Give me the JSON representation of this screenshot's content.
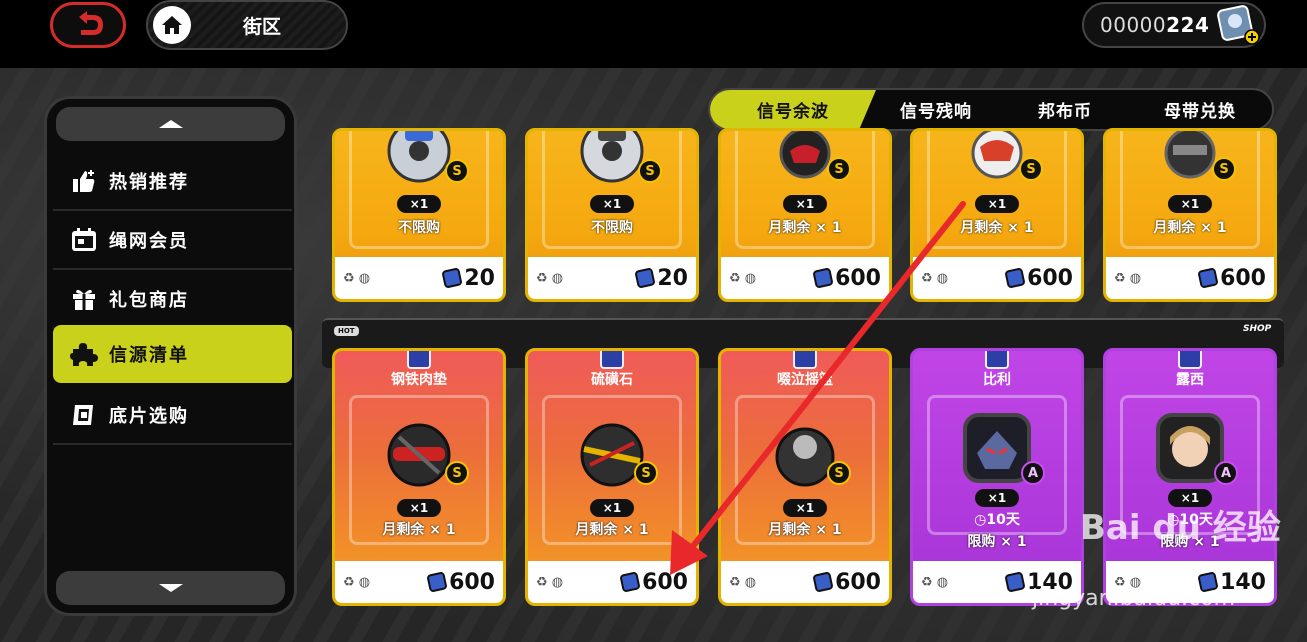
{
  "header": {
    "location": "街区",
    "currency_dim": "00000",
    "currency_value": "224"
  },
  "sidebar": {
    "items": [
      {
        "label": "热销推荐",
        "icon": "thumbs-up-icon"
      },
      {
        "label": "绳网会员",
        "icon": "calendar-card-icon"
      },
      {
        "label": "礼包商店",
        "icon": "gift-icon"
      },
      {
        "label": "信源清单",
        "icon": "puzzle-icon"
      },
      {
        "label": "底片选购",
        "icon": "film-icon"
      }
    ],
    "active_index": 3
  },
  "tabs": [
    {
      "label": "信号余波"
    },
    {
      "label": "信号残响"
    },
    {
      "label": "邦布币"
    },
    {
      "label": "母带兑换"
    }
  ],
  "active_tab": 0,
  "band": {
    "hot_label": "HOT",
    "shop_label": "SHOP"
  },
  "top_row": [
    {
      "qty": "×1",
      "limit": "不限购",
      "price": "20",
      "rank": "S"
    },
    {
      "qty": "×1",
      "limit": "不限购",
      "price": "20",
      "rank": "S"
    },
    {
      "qty": "×1",
      "limit": "月剩余 × 1",
      "price": "600",
      "rank": "S"
    },
    {
      "qty": "×1",
      "limit": "月剩余 × 1",
      "price": "600",
      "rank": "S"
    },
    {
      "qty": "×1",
      "limit": "月剩余 × 1",
      "price": "600",
      "rank": "S"
    }
  ],
  "bottom_row": [
    {
      "name": "钢铁肉垫",
      "qty": "×1",
      "limit": "月剩余 × 1",
      "price": "600",
      "rank": "S",
      "color": "red"
    },
    {
      "name": "硫磺石",
      "qty": "×1",
      "limit": "月剩余 × 1",
      "price": "600",
      "rank": "S",
      "color": "red"
    },
    {
      "name": "啜泣摇篮",
      "qty": "×1",
      "limit": "月剩余 × 1",
      "price": "600",
      "rank": "S",
      "color": "red"
    },
    {
      "name": "比利",
      "qty": "×1",
      "duration": "10天",
      "limit": "限购 × 1",
      "price": "140",
      "rank": "A",
      "color": "purple"
    },
    {
      "name": "露西",
      "qty": "×1",
      "duration": "10天",
      "limit": "限购 × 1",
      "price": "140",
      "rank": "A",
      "color": "purple"
    }
  ],
  "watermark": {
    "brand": "Bai du 经验",
    "url": "jingyan.baidu.com"
  },
  "colors": {
    "accent": "#c9d11a",
    "arrow": "#e8282a",
    "back_ring": "#d42b2b"
  }
}
